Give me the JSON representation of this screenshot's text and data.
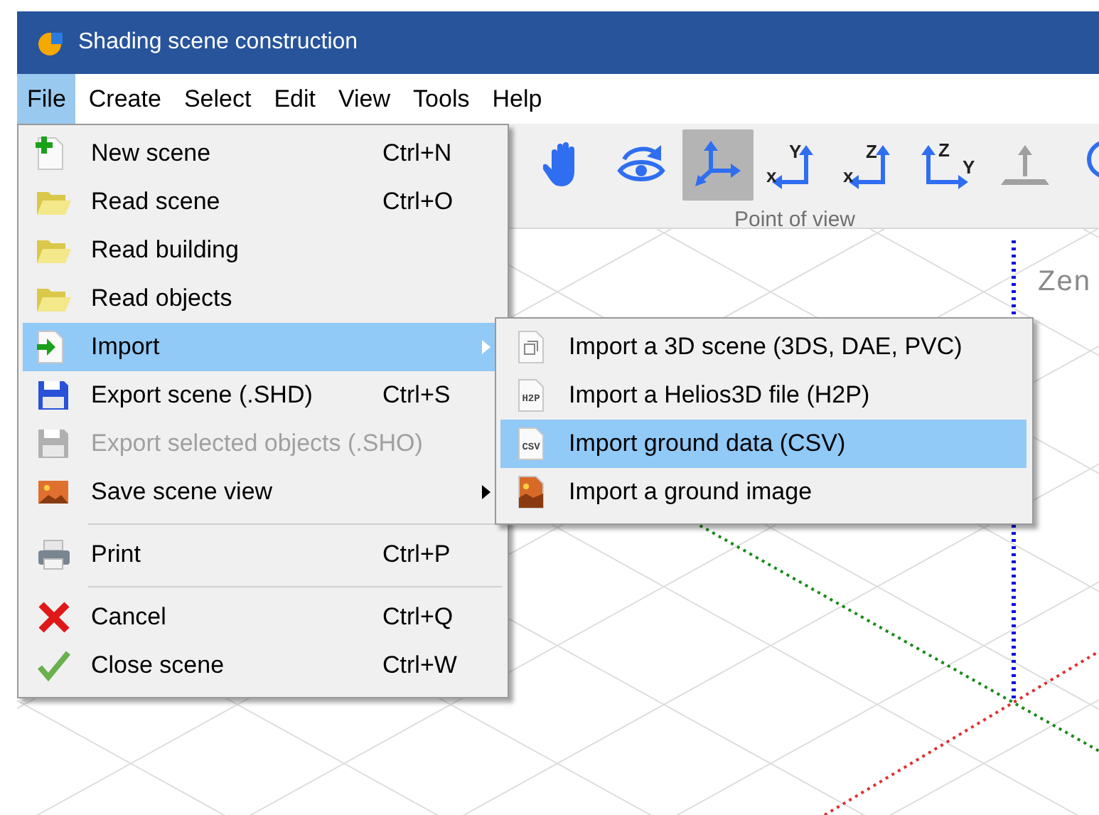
{
  "window": {
    "title": "Shading scene construction"
  },
  "menu_bar": [
    {
      "label": "File",
      "selected": true
    },
    {
      "label": "Create",
      "selected": false
    },
    {
      "label": "Select",
      "selected": false
    },
    {
      "label": "Edit",
      "selected": false
    },
    {
      "label": "View",
      "selected": false
    },
    {
      "label": "Tools",
      "selected": false
    },
    {
      "label": "Help",
      "selected": false
    }
  ],
  "toolbar": {
    "group_label": "Point of view",
    "buttons": [
      {
        "selected": false,
        "disabled": false
      },
      {
        "selected": false,
        "disabled": false
      },
      {
        "selected": true,
        "disabled": false
      },
      {
        "selected": false,
        "disabled": false,
        "letters": [
          "x",
          "Y"
        ]
      },
      {
        "selected": false,
        "disabled": false,
        "letters": [
          "x",
          "Z"
        ]
      },
      {
        "selected": false,
        "disabled": false,
        "letters": [
          "Z",
          "Y"
        ]
      },
      {
        "selected": false,
        "disabled": true
      }
    ]
  },
  "scene": {
    "axis_label": "Zen"
  },
  "file_menu": [
    {
      "label": "New scene",
      "shortcut": "Ctrl+N",
      "selected": false,
      "disabled": false,
      "submenu": false,
      "separator_before": false
    },
    {
      "label": "Read scene",
      "shortcut": "Ctrl+O",
      "selected": false,
      "disabled": false,
      "submenu": false,
      "separator_before": false
    },
    {
      "label": "Read building",
      "selected": false,
      "disabled": false,
      "submenu": false,
      "separator_before": false
    },
    {
      "label": "Read objects",
      "selected": false,
      "disabled": false,
      "submenu": false,
      "separator_before": false
    },
    {
      "label": "Import",
      "selected": true,
      "disabled": false,
      "submenu": true,
      "separator_before": false
    },
    {
      "label": "Export scene (.SHD)",
      "shortcut": "Ctrl+S",
      "selected": false,
      "disabled": false,
      "submenu": false,
      "separator_before": false
    },
    {
      "label": "Export selected objects (.SHO)",
      "selected": false,
      "disabled": true,
      "submenu": false,
      "separator_before": false
    },
    {
      "label": "Save scene view",
      "selected": false,
      "disabled": false,
      "submenu": true,
      "separator_before": false
    },
    {
      "label": "Print",
      "shortcut": "Ctrl+P",
      "selected": false,
      "disabled": false,
      "submenu": false,
      "separator_before": true
    },
    {
      "label": "Cancel",
      "shortcut": "Ctrl+Q",
      "selected": false,
      "disabled": false,
      "submenu": false,
      "separator_before": true
    },
    {
      "label": "Close scene",
      "shortcut": "Ctrl+W",
      "selected": false,
      "disabled": false,
      "submenu": false,
      "separator_before": false
    }
  ],
  "import_submenu": [
    {
      "label": "Import a 3D scene (3DS, DAE, PVC)",
      "selected": false
    },
    {
      "label": "Import a Helios3D file (H2P)",
      "icon_text": "H2P",
      "selected": false
    },
    {
      "label": "Import ground data (CSV)",
      "icon_text": "CSV",
      "selected": true
    },
    {
      "label": "Import a ground image",
      "selected": false
    }
  ]
}
